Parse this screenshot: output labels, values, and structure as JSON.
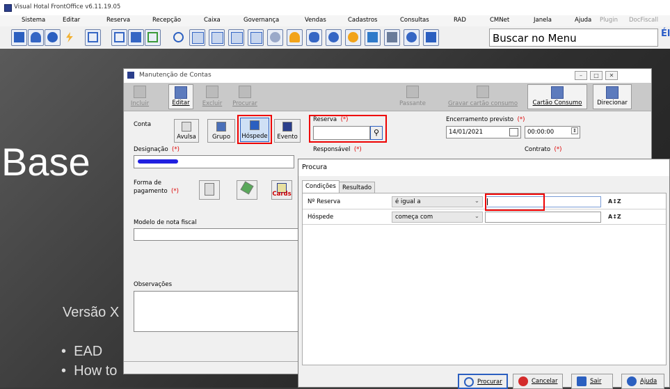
{
  "app": {
    "title": "Visual Hotal FrontOffice v6.11.19.05"
  },
  "menu": [
    "Sistema",
    "Editar",
    "Reserva",
    "Recepção",
    "Caixa",
    "Governança",
    "Vendas",
    "Cadastros",
    "Consultas",
    "RAD",
    "CMNet",
    "Janela",
    "Ajuda",
    "Plugin",
    "DocFiscall"
  ],
  "toolbar": {
    "search_label": "Buscar no Menu",
    "cut_text": "Él"
  },
  "background": {
    "big_text": "Base",
    "versao": "Versão X",
    "bullets": [
      "EAD",
      "How to"
    ]
  },
  "window": {
    "title": "Manutenção de Contas",
    "toolbar": {
      "incluir": "Incluir",
      "editar": "Editar",
      "excluir": "Excluir",
      "procurar": "Procurar",
      "passante": "Passante",
      "gravar": "Gravar cartão consumo",
      "cartao": "Cartão Consumo",
      "direcionar": "Direcionar"
    },
    "conta_label": "Conta",
    "conta_buttons": {
      "avulsa": "Avulsa",
      "grupo": "Grupo",
      "hospede": "Hóspede",
      "evento": "Evento"
    },
    "reserva_label": "Reserva",
    "encerramento_label": "Encerramento previsto",
    "encerramento_date": "14/01/2021",
    "encerramento_time": "00:00:00",
    "designacao_label": "Designação",
    "responsavel_label": "Responsável",
    "contrato_label": "Contrato",
    "forma_label_1": "Forma de",
    "forma_label_2": "pagamento",
    "cards_label": "Cards",
    "modelo_label": "Modelo de nota fiscal",
    "obs_label": "Observações",
    "required_mark": "(*)"
  },
  "dialog": {
    "title": "Procura",
    "tabs": [
      "Condições",
      "Resultado"
    ],
    "rows": [
      {
        "field": "Nº Reserva",
        "op": "é igual a",
        "value": ""
      },
      {
        "field": "Hóspede",
        "op": "começa com",
        "value": ""
      }
    ],
    "sort_label": "A↕Z",
    "buttons": {
      "procurar": "Procurar",
      "cancelar": "Cancelar",
      "sair": "Sair",
      "ajuda": "Ajuda"
    }
  },
  "colors": {
    "highlight": "#e00000",
    "primary_btn": "#2b5fc0",
    "cancel": "#d42b2b"
  }
}
